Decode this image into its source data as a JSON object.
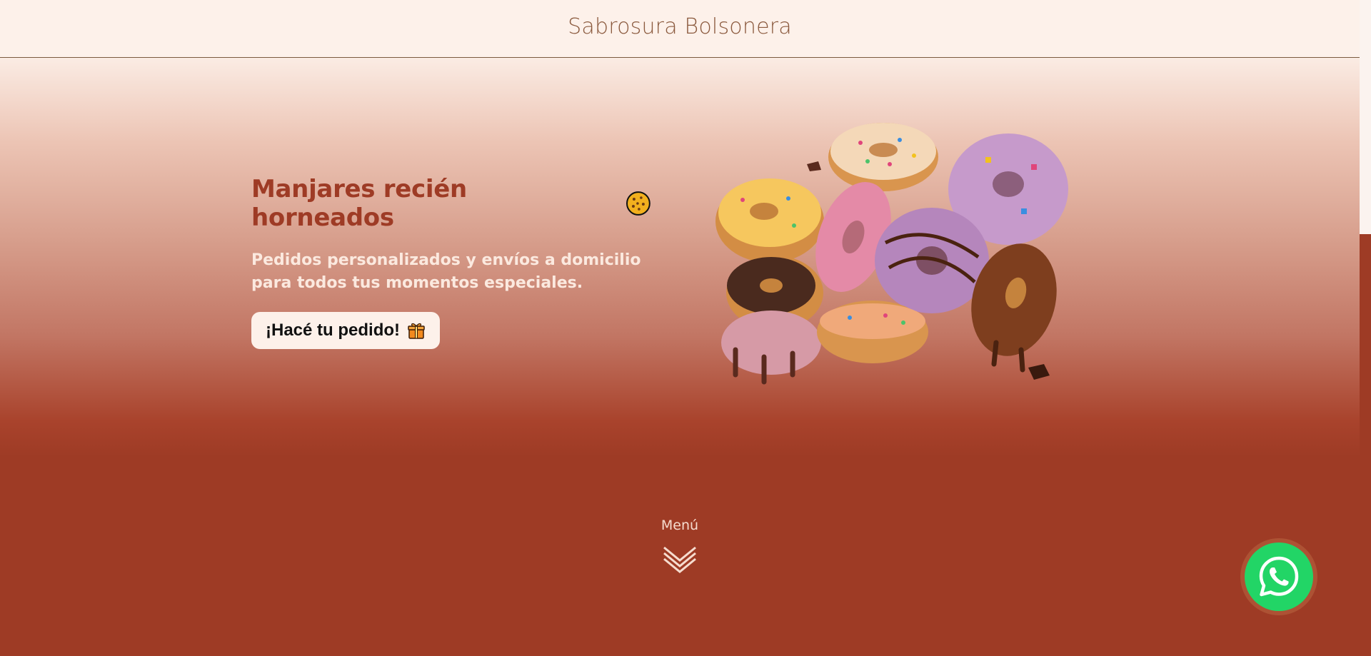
{
  "header": {
    "brand": "Sabrosura Bolsonera"
  },
  "hero": {
    "title": "Manjares recién horneados",
    "title_icon": "cookie-icon",
    "subtitle": "Pedidos personalizados y envíos a domicilio para todos tus momentos especiales.",
    "cta_label": "¡Hacé tu pedido!",
    "cta_icon": "gift-icon",
    "image_subject": "donuts"
  },
  "menu_cue": {
    "label": "Menú",
    "icon": "double-chevron-down-icon"
  },
  "whatsapp": {
    "icon": "whatsapp-icon"
  },
  "colors": {
    "header_bg": "#fdf1ea",
    "brand_text": "#8b5a3e",
    "accent": "#9e3b25",
    "whatsapp_green": "#22d566"
  }
}
